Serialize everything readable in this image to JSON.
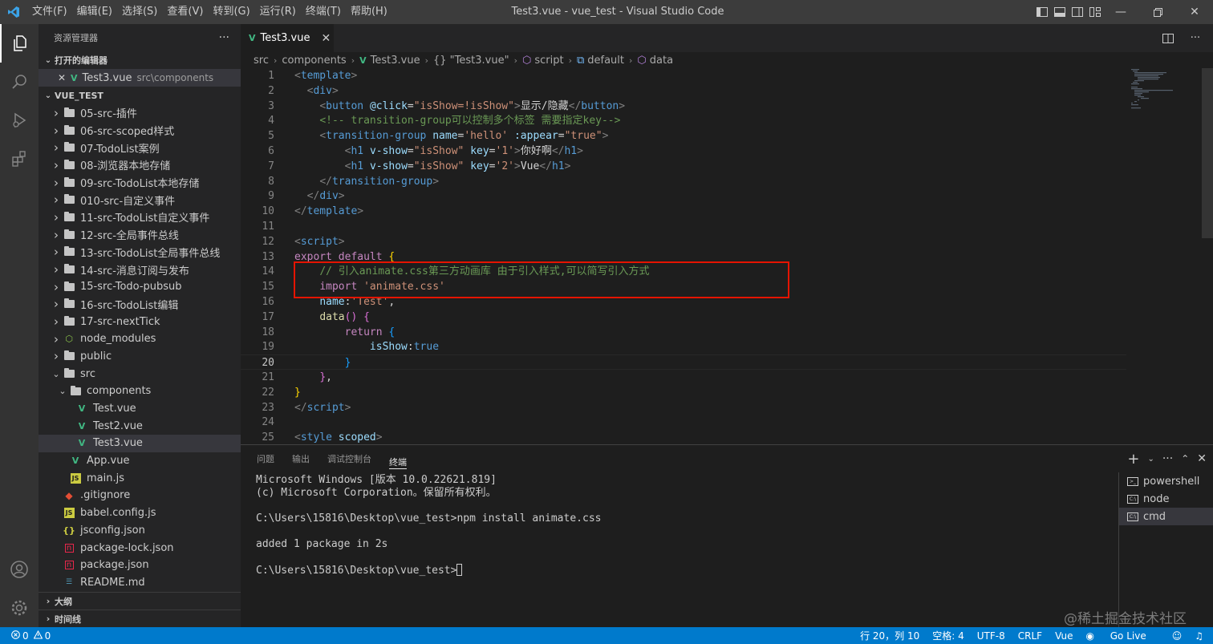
{
  "titlebar": {
    "menus": [
      "文件(F)",
      "编辑(E)",
      "选择(S)",
      "查看(V)",
      "转到(G)",
      "运行(R)",
      "终端(T)",
      "帮助(H)"
    ],
    "window_title": "Test3.vue - vue_test - Visual Studio Code"
  },
  "sidebar": {
    "title": "资源管理器",
    "more": "···",
    "open_editors_label": "打开的编辑器",
    "open_editor": {
      "name": "Test3.vue",
      "path": "src\\components"
    },
    "project_label": "VUE_TEST",
    "tree": [
      {
        "name": "05-src-插件",
        "type": "folder",
        "indent": 0
      },
      {
        "name": "06-src-scoped样式",
        "type": "folder",
        "indent": 0
      },
      {
        "name": "07-TodoList案例",
        "type": "folder",
        "indent": 0
      },
      {
        "name": "08-浏览器本地存储",
        "type": "folder",
        "indent": 0
      },
      {
        "name": "09-src-TodoList本地存储",
        "type": "folder",
        "indent": 0
      },
      {
        "name": "010-src-自定义事件",
        "type": "folder",
        "indent": 0
      },
      {
        "name": "11-src-TodoList自定义事件",
        "type": "folder",
        "indent": 0
      },
      {
        "name": "12-src-全局事件总线",
        "type": "folder",
        "indent": 0
      },
      {
        "name": "13-src-TodoList全局事件总线",
        "type": "folder",
        "indent": 0
      },
      {
        "name": "14-src-消息订阅与发布",
        "type": "folder",
        "indent": 0
      },
      {
        "name": "15-src-Todo-pubsub",
        "type": "folder",
        "indent": 0
      },
      {
        "name": "16-src-TodoList编辑",
        "type": "folder",
        "indent": 0
      },
      {
        "name": "17-src-nextTick",
        "type": "folder",
        "indent": 0
      },
      {
        "name": "node_modules",
        "type": "node_modules",
        "indent": 0
      },
      {
        "name": "public",
        "type": "folder",
        "indent": 0
      },
      {
        "name": "src",
        "type": "folder-open",
        "indent": 0
      },
      {
        "name": "components",
        "type": "folder-open",
        "indent": 1
      },
      {
        "name": "Test.vue",
        "type": "vue",
        "indent": 2
      },
      {
        "name": "Test2.vue",
        "type": "vue",
        "indent": 2
      },
      {
        "name": "Test3.vue",
        "type": "vue",
        "indent": 2,
        "selected": true
      },
      {
        "name": "App.vue",
        "type": "vue",
        "indent": 1
      },
      {
        "name": "main.js",
        "type": "js",
        "indent": 1
      },
      {
        "name": ".gitignore",
        "type": "git",
        "indent": 0
      },
      {
        "name": "babel.config.js",
        "type": "js",
        "indent": 0
      },
      {
        "name": "jsconfig.json",
        "type": "json",
        "indent": 0
      },
      {
        "name": "package-lock.json",
        "type": "pkg",
        "indent": 0
      },
      {
        "name": "package.json",
        "type": "pkg",
        "indent": 0
      },
      {
        "name": "README.md",
        "type": "md",
        "indent": 0
      }
    ],
    "outline_label": "大纲",
    "timeline_label": "时间线"
  },
  "tab": {
    "label": "Test3.vue"
  },
  "breadcrumb": [
    "src",
    "components",
    "Test3.vue",
    "{} \"Test3.vue\"",
    "script",
    "default",
    "data"
  ],
  "editor": {
    "current_line": 20,
    "lines": [
      {
        "n": "1",
        "tokens": [
          [
            "br",
            "<"
          ],
          [
            "tag",
            "template"
          ],
          [
            "br",
            ">"
          ]
        ]
      },
      {
        "n": "2",
        "tokens": [
          [
            "txt",
            "  "
          ],
          [
            "br",
            "<"
          ],
          [
            "tag",
            "div"
          ],
          [
            "br",
            ">"
          ]
        ]
      },
      {
        "n": "3",
        "tokens": [
          [
            "txt",
            "    "
          ],
          [
            "br",
            "<"
          ],
          [
            "tag",
            "button"
          ],
          [
            "txt",
            " "
          ],
          [
            "attr",
            "@click"
          ],
          [
            "txt",
            "="
          ],
          [
            "str",
            "\"isShow=!isShow\""
          ],
          [
            "br",
            ">"
          ],
          [
            "txt",
            "显示/隐藏"
          ],
          [
            "br",
            "</"
          ],
          [
            "tag",
            "button"
          ],
          [
            "br",
            ">"
          ]
        ]
      },
      {
        "n": "4",
        "tokens": [
          [
            "txt",
            "    "
          ],
          [
            "com",
            "<!-- transition-group可以控制多个标签 需要指定key-->"
          ]
        ]
      },
      {
        "n": "5",
        "tokens": [
          [
            "txt",
            "    "
          ],
          [
            "br",
            "<"
          ],
          [
            "tag",
            "transition-group"
          ],
          [
            "txt",
            " "
          ],
          [
            "attr",
            "name"
          ],
          [
            "txt",
            "="
          ],
          [
            "str",
            "'hello'"
          ],
          [
            "txt",
            " "
          ],
          [
            "attr",
            ":appear"
          ],
          [
            "txt",
            "="
          ],
          [
            "str",
            "\"true\""
          ],
          [
            "br",
            ">"
          ]
        ]
      },
      {
        "n": "6",
        "tokens": [
          [
            "txt",
            "        "
          ],
          [
            "br",
            "<"
          ],
          [
            "tag",
            "h1"
          ],
          [
            "txt",
            " "
          ],
          [
            "attr",
            "v-show"
          ],
          [
            "txt",
            "="
          ],
          [
            "str",
            "\"isShow\""
          ],
          [
            "txt",
            " "
          ],
          [
            "attr",
            "key"
          ],
          [
            "txt",
            "="
          ],
          [
            "str",
            "'1'"
          ],
          [
            "br",
            ">"
          ],
          [
            "txt",
            "你好啊"
          ],
          [
            "br",
            "</"
          ],
          [
            "tag",
            "h1"
          ],
          [
            "br",
            ">"
          ]
        ]
      },
      {
        "n": "7",
        "tokens": [
          [
            "txt",
            "        "
          ],
          [
            "br",
            "<"
          ],
          [
            "tag",
            "h1"
          ],
          [
            "txt",
            " "
          ],
          [
            "attr",
            "v-show"
          ],
          [
            "txt",
            "="
          ],
          [
            "str",
            "\"isShow\""
          ],
          [
            "txt",
            " "
          ],
          [
            "attr",
            "key"
          ],
          [
            "txt",
            "="
          ],
          [
            "str",
            "'2'"
          ],
          [
            "br",
            ">"
          ],
          [
            "txt",
            "Vue"
          ],
          [
            "br",
            "</"
          ],
          [
            "tag",
            "h1"
          ],
          [
            "br",
            ">"
          ]
        ]
      },
      {
        "n": "8",
        "tokens": [
          [
            "txt",
            "    "
          ],
          [
            "br",
            "</"
          ],
          [
            "tag",
            "transition-group"
          ],
          [
            "br",
            ">"
          ]
        ]
      },
      {
        "n": "9",
        "tokens": [
          [
            "txt",
            "  "
          ],
          [
            "br",
            "</"
          ],
          [
            "tag",
            "div"
          ],
          [
            "br",
            ">"
          ]
        ]
      },
      {
        "n": "10",
        "tokens": [
          [
            "br",
            "</"
          ],
          [
            "tag",
            "template"
          ],
          [
            "br",
            ">"
          ]
        ]
      },
      {
        "n": "11",
        "tokens": []
      },
      {
        "n": "12",
        "tokens": [
          [
            "br",
            "<"
          ],
          [
            "tag",
            "script"
          ],
          [
            "br",
            ">"
          ]
        ]
      },
      {
        "n": "13",
        "tokens": [
          [
            "kw",
            "export"
          ],
          [
            "txt",
            " "
          ],
          [
            "kw",
            "default"
          ],
          [
            "txt",
            " "
          ],
          [
            "y",
            "{"
          ]
        ]
      },
      {
        "n": "14",
        "tokens": [
          [
            "txt",
            "    "
          ],
          [
            "com",
            "// 引入animate.css第三方动画库 由于引入样式,可以简写引入方式"
          ]
        ]
      },
      {
        "n": "15",
        "tokens": [
          [
            "txt",
            "    "
          ],
          [
            "kw",
            "import"
          ],
          [
            "txt",
            " "
          ],
          [
            "str",
            "'animate.css'"
          ]
        ]
      },
      {
        "n": "16",
        "tokens": [
          [
            "txt",
            "    "
          ],
          [
            "attr",
            "name"
          ],
          [
            "txt",
            ":"
          ],
          [
            "str",
            "'Test'"
          ],
          [
            "txt",
            ","
          ]
        ]
      },
      {
        "n": "17",
        "tokens": [
          [
            "txt",
            "    "
          ],
          [
            "fn",
            "data"
          ],
          [
            "p",
            "()"
          ],
          [
            "txt",
            " "
          ],
          [
            "p",
            "{"
          ]
        ]
      },
      {
        "n": "18",
        "tokens": [
          [
            "txt",
            "        "
          ],
          [
            "kw",
            "return"
          ],
          [
            "txt",
            " "
          ],
          [
            "b",
            "{"
          ]
        ]
      },
      {
        "n": "19",
        "tokens": [
          [
            "txt",
            "            "
          ],
          [
            "attr",
            "isShow"
          ],
          [
            "txt",
            ":"
          ],
          [
            "key",
            "true"
          ]
        ]
      },
      {
        "n": "20",
        "tokens": [
          [
            "txt",
            "        "
          ],
          [
            "b",
            "}"
          ]
        ]
      },
      {
        "n": "21",
        "tokens": [
          [
            "txt",
            "    "
          ],
          [
            "p",
            "}"
          ],
          [
            "txt",
            ","
          ]
        ]
      },
      {
        "n": "22",
        "tokens": [
          [
            "y",
            "}"
          ]
        ]
      },
      {
        "n": "23",
        "tokens": [
          [
            "br",
            "</"
          ],
          [
            "tag",
            "script"
          ],
          [
            "br",
            ">"
          ]
        ]
      },
      {
        "n": "24",
        "tokens": []
      },
      {
        "n": "25",
        "tokens": [
          [
            "br",
            "<"
          ],
          [
            "tag",
            "style"
          ],
          [
            "txt",
            " "
          ],
          [
            "attr",
            "scoped"
          ],
          [
            "br",
            ">"
          ]
        ]
      }
    ]
  },
  "panel": {
    "tabs": [
      "问题",
      "输出",
      "调试控制台",
      "终端"
    ],
    "active_tab": 3,
    "terminal_lines": [
      "Microsoft Windows [版本 10.0.22621.819]",
      "(c) Microsoft Corporation。保留所有权利。",
      "",
      "C:\\Users\\15816\\Desktop\\vue_test>npm install animate.css",
      "",
      "added 1 package in 2s",
      "",
      "C:\\Users\\15816\\Desktop\\vue_test>"
    ],
    "terminals": [
      "powershell",
      "node",
      "cmd"
    ],
    "active_terminal": 2
  },
  "statusbar": {
    "errors": "0",
    "warnings": "0",
    "position": "行 20，列 10",
    "spaces": "空格: 4",
    "encoding": "UTF-8",
    "eol": "CRLF",
    "language": "Vue",
    "golive": "Go Live"
  },
  "watermark": "@稀土掘金技术社区",
  "colors": {
    "accent": "#007acc",
    "highlight_box": "#e51400",
    "vue_green": "#41b883"
  }
}
